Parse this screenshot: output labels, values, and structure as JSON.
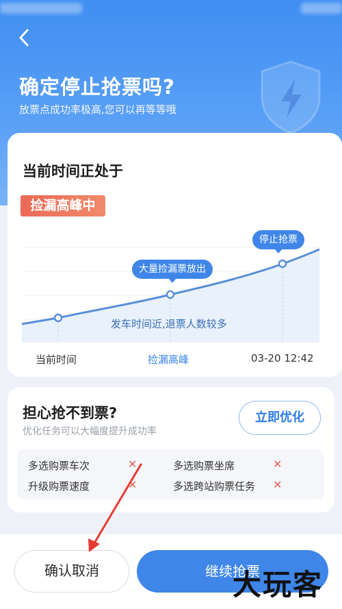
{
  "header": {
    "title": "确定停止抢票吗?",
    "subtitle": "放票点成功率极高,您可以再等等哦"
  },
  "status_card": {
    "title": "当前时间正处于",
    "badge": "捡漏高峰中",
    "chart": {
      "bubble_peak": "大量捡漏票放出",
      "bubble_stop": "停止抢票",
      "note": "发车时间近,退票人数较多",
      "x_labels": [
        "当前时间",
        "捡漏高峰",
        "03-20 12:42"
      ]
    }
  },
  "optimize_card": {
    "title": "担心抢不到票?",
    "subtitle": "优化任务可以大幅度提升成功率",
    "button": "立即优化",
    "items": [
      {
        "label": "多选购票车次",
        "mark": "✕"
      },
      {
        "label": "多选购票坐席",
        "mark": "✕"
      },
      {
        "label": "升级购票速度",
        "mark": "✕"
      },
      {
        "label": "多选跨站购票任务",
        "mark": "✕"
      }
    ]
  },
  "footer": {
    "cancel": "确认取消",
    "continue": "继续抢票"
  },
  "watermark": "大玩客",
  "colors": {
    "primary": "#3f86e8",
    "badge": "#ec6a57",
    "cross": "#e46352"
  }
}
